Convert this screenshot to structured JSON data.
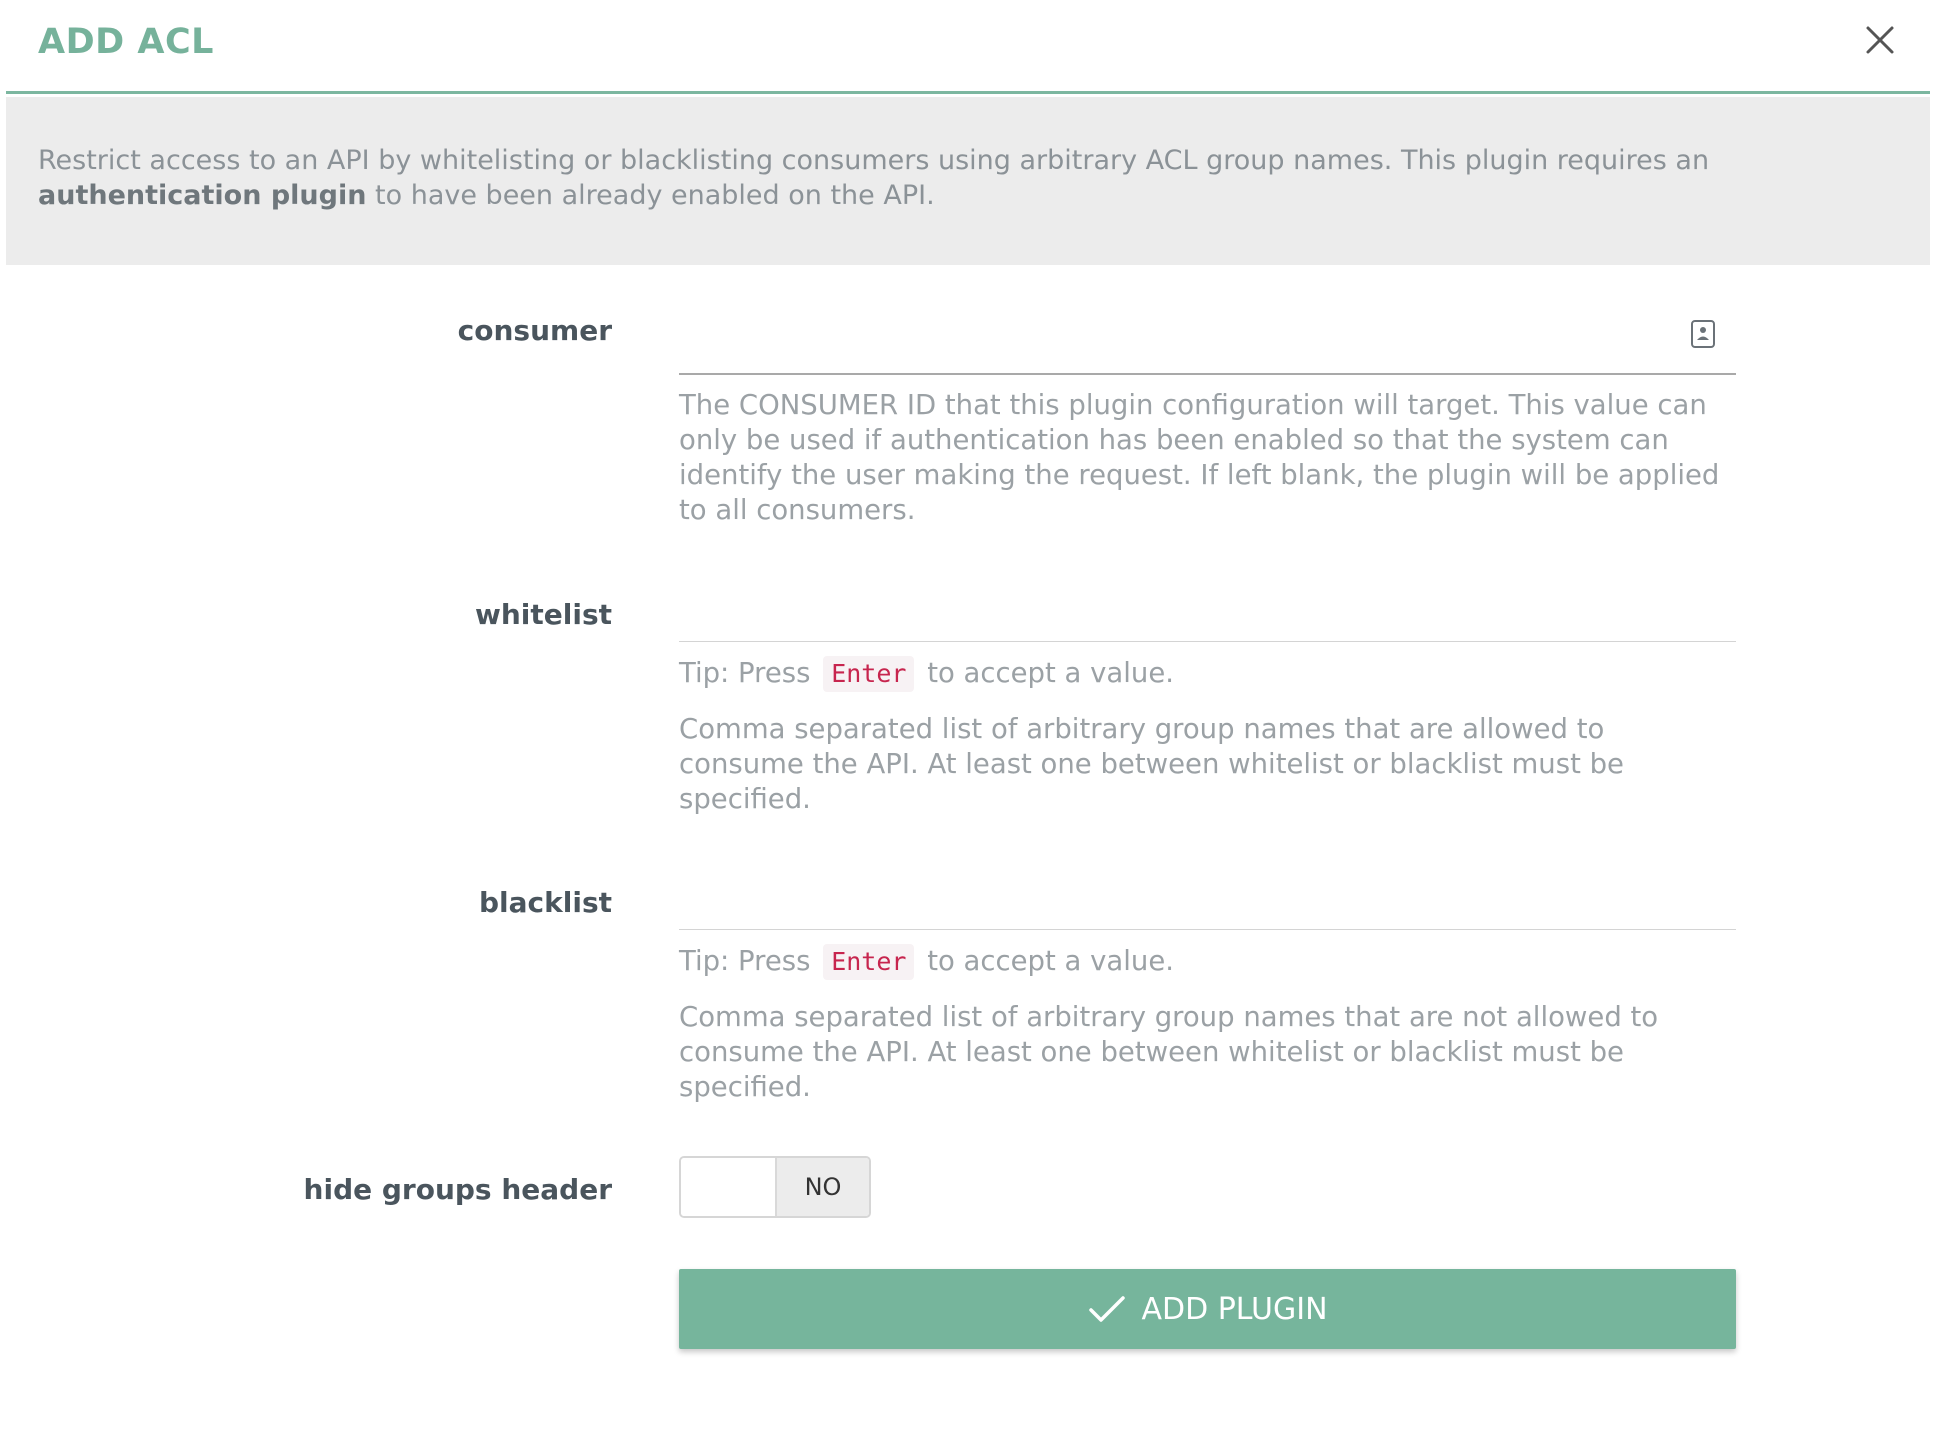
{
  "dialog": {
    "title": "ADD ACL",
    "description_text": "Restrict access to an API by whitelisting or blacklisting consumers using arbitrary ACL group names. This plugin requires an",
    "description_bold": "authentication plugin",
    "description_tail": "to have been already enabled on the API."
  },
  "fields": {
    "consumer": {
      "label": "consumer",
      "value": "",
      "help": "The CONSUMER ID that this plugin configuration will target. This value can only be used if authentication has been enabled so that the system can identify the user making the request. If left blank, the plugin will be applied to all consumers."
    },
    "whitelist": {
      "label": "whitelist",
      "value": "",
      "tip_prefix": "Tip: Press",
      "tip_key": "Enter",
      "tip_suffix": "to accept a value.",
      "help": "Comma separated list of arbitrary group names that are allowed to consume the API. At least one between whitelist or blacklist must be specified."
    },
    "blacklist": {
      "label": "blacklist",
      "value": "",
      "tip_prefix": "Tip: Press",
      "tip_key": "Enter",
      "tip_suffix": "to accept a value.",
      "help": "Comma separated list of arbitrary group names that are not allowed to consume the API. At least one between whitelist or blacklist must be specified."
    },
    "hide_groups_header": {
      "label": "hide groups header",
      "state": "NO"
    }
  },
  "actions": {
    "submit_label": "ADD PLUGIN"
  },
  "icons": {
    "close": "close-icon",
    "consumer_picker": "contact-card-icon",
    "submit": "check-icon"
  },
  "colors": {
    "accent": "#76b59c",
    "title": "#76b29b",
    "description_bg": "#ececec",
    "tip_key": "#c7254e"
  }
}
